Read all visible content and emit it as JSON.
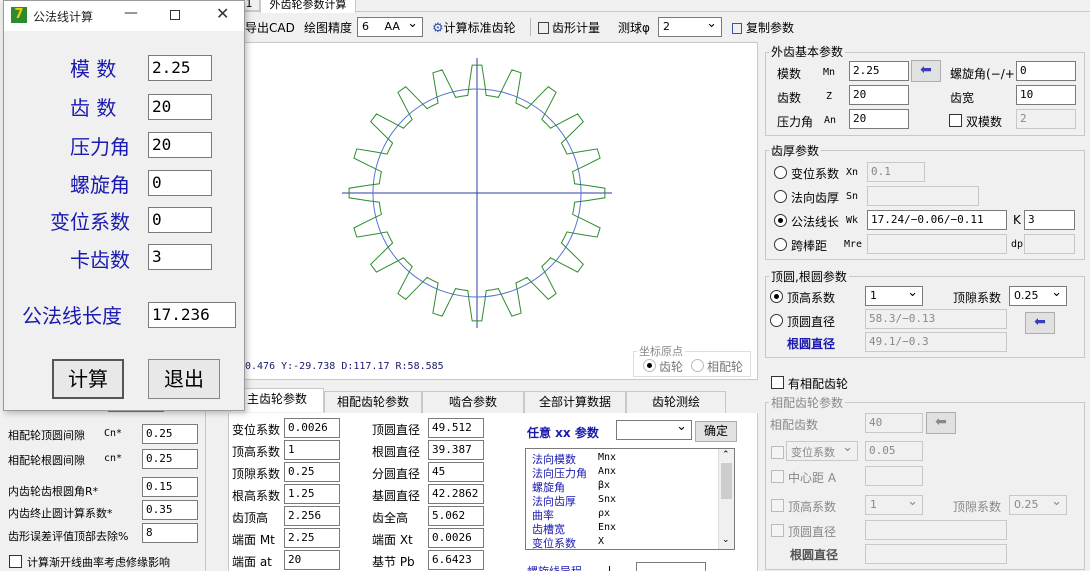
{
  "top_tabs": {
    "partial": "1",
    "main": "外齿轮参数计算"
  },
  "toolbar": {
    "export_cad": "导出CAD",
    "precision_label": "绘图精度",
    "precision_value": "6",
    "aa_value": "AA",
    "calc_std_gear": "计算标准齿轮",
    "tooth_gauge": "齿形计量",
    "ball_label": "测球φ",
    "ball_value": "2",
    "copy_params": "复制参数"
  },
  "canvas": {
    "status": "0.476  Y:-29.738 D:117.17  R:58.585",
    "origin_title": "坐标原点",
    "origin_gear": "齿轮",
    "origin_mate": "相配轮",
    "tooth_count": 20
  },
  "basic": {
    "title": "外齿基本参数",
    "module_label": "模数",
    "module_sym": "Mn",
    "module_value": "2.25",
    "helix_label": "螺旋角(−/+)",
    "helix_value": "0",
    "teeth_label": "齿数",
    "teeth_sym": "Z",
    "teeth_value": "20",
    "width_label": "齿宽",
    "width_value": "10",
    "pressure_label": "压力角",
    "pressure_sym": "An",
    "pressure_value": "20",
    "double_label": "双模数",
    "double_value": "2"
  },
  "thickness": {
    "title": "齿厚参数",
    "shift_label": "变位系数",
    "shift_sym": "Xn",
    "shift_value": "0.1",
    "normal_label": "法向齿厚",
    "normal_sym": "Sn",
    "wk_label": "公法线长",
    "wk_sym": "Wk",
    "wk_value": "17.24/−0.06/−0.11",
    "k_label": "K",
    "k_value": "3",
    "mre_label": "跨棒距",
    "mre_sym": "Mre",
    "dp_label": "dp"
  },
  "tip_root": {
    "title": "顶圆,根圆参数",
    "addendum_label": "顶高系数",
    "addendum_value": "1",
    "clearance_label": "顶隙系数",
    "clearance_value": "0.25",
    "tip_label": "顶圆直径",
    "tip_value": "58.3/−0.13",
    "root_label": "根圆直径",
    "root_value": "49.1/−0.3"
  },
  "mate": {
    "has_mate": "有相配齿轮",
    "title": "相配齿轮参数",
    "teeth_label": "相配齿数",
    "teeth_value": "40",
    "shift_label": "变位系数",
    "shift_value": "0.05",
    "center_label": "中心距 A",
    "addendum_label": "顶高系数",
    "addendum_value": "1",
    "clearance_label": "顶隙系数",
    "clearance_value": "0.25",
    "tip_label": "顶圆直径",
    "root_label": "根圆直径"
  },
  "dialog": {
    "title": "公法线计算",
    "module_label": "模  数",
    "module_value": "2.25",
    "teeth_label": "齿  数",
    "teeth_value": "20",
    "pressure_label": "压力角",
    "pressure_value": "20",
    "helix_label": "螺旋角",
    "helix_value": "0",
    "shift_label": "变位系数",
    "shift_value": "0",
    "span_label": "卡齿数",
    "span_value": "3",
    "result_label": "公法线长度",
    "result_value": "17.236",
    "calc_button": "计算",
    "exit_button": "退出"
  },
  "left_panel": {
    "mate_tip_clear_label": "相配轮顶圆间隙",
    "mate_tip_clear_sym": "Cn*",
    "mate_tip_clear_value": "0.25",
    "mate_root_clear_label": "相配轮根圆间隙",
    "mate_root_clear_sym": "cn*",
    "mate_root_clear_value": "0.25",
    "inner_root_r_label": "内齿轮齿根圆角R*",
    "inner_root_r_value": "0.15",
    "inner_end_label": "内齿终止圆计算系数*",
    "inner_end_value": "0.35",
    "profile_err_label": "齿形误差评值顶部去除%",
    "profile_err_value": "8",
    "involute_check": "计算渐开线曲率考虑修缘影响"
  },
  "bottom_tabs": [
    "主齿轮参数",
    "相配齿轮参数",
    "啮合参数",
    "全部计算数据",
    "齿轮测绘"
  ],
  "main_params": {
    "rows": [
      {
        "l1": "变位系数",
        "v1": "0.0026",
        "l2": "顶圆直径",
        "v2": "49.512"
      },
      {
        "l1": "顶高系数",
        "v1": "1",
        "l2": "根圆直径",
        "v2": "39.387"
      },
      {
        "l1": "顶隙系数",
        "v1": "0.25",
        "l2": "分圆直径",
        "v2": "45"
      },
      {
        "l1": "根高系数",
        "v1": "1.25",
        "l2": "基圆直径",
        "v2": "42.2862"
      },
      {
        "l1": "齿顶高",
        "v1": "2.256",
        "l2": "齿全高",
        "v2": "5.062"
      },
      {
        "l1": "端面 Mt",
        "v1": "2.25",
        "l2": "端面 Xt",
        "v2": "0.0026"
      },
      {
        "l1": "端面 at",
        "v1": "20",
        "l2": "基节 Pb",
        "v2": "6.6423"
      }
    ],
    "any_title": "任意 xx 参数",
    "confirm": "确定",
    "list": [
      {
        "name": "法向模数",
        "sym": "Mnx"
      },
      {
        "name": "法向压力角",
        "sym": "Anx"
      },
      {
        "name": "螺旋角",
        "sym": "βx"
      },
      {
        "name": "法向齿厚",
        "sym": "Snx"
      },
      {
        "name": "曲率",
        "sym": "ρx"
      },
      {
        "name": "齿槽宽",
        "sym": "Enx"
      },
      {
        "name": "变位系数",
        "sym": "X"
      }
    ],
    "helix_lead_label": "螺旋线导程",
    "helix_lead_sym": "L"
  },
  "colors": {
    "dialog_label": "#1a1ab0",
    "gear_outline": "#2e8b2e",
    "circle": "#5577cc",
    "axis": "#2a3f9f"
  }
}
